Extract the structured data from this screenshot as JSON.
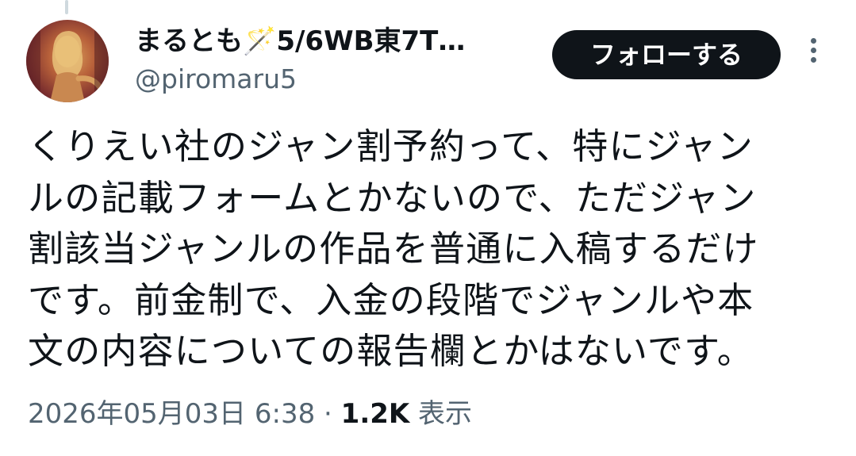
{
  "user": {
    "display_name": "まるとも🪄5/6WB東7T…",
    "handle": "@piromaru5"
  },
  "actions": {
    "follow_label": "フォローする",
    "more_icon": "more-vertical-icon"
  },
  "tweet": {
    "lines": [
      "くりえい社のジャン割予約って、特にジャン",
      "ルの記載フォームとかないので、ただジャン",
      "割該当ジャンルの作品を普通に入稿するだけ",
      "です。前金制で、入金の段階でジャンルや本",
      "文の内容についての報告欄とかはないです。"
    ]
  },
  "meta": {
    "timestamp": "2026年05月03日 6:38",
    "separator": " · ",
    "views_count": "1.2K",
    "views_label": " 表示"
  },
  "colors": {
    "text_primary": "#0f1419",
    "text_secondary": "#536471",
    "button_bg": "#0f1419",
    "button_text": "#ffffff"
  }
}
